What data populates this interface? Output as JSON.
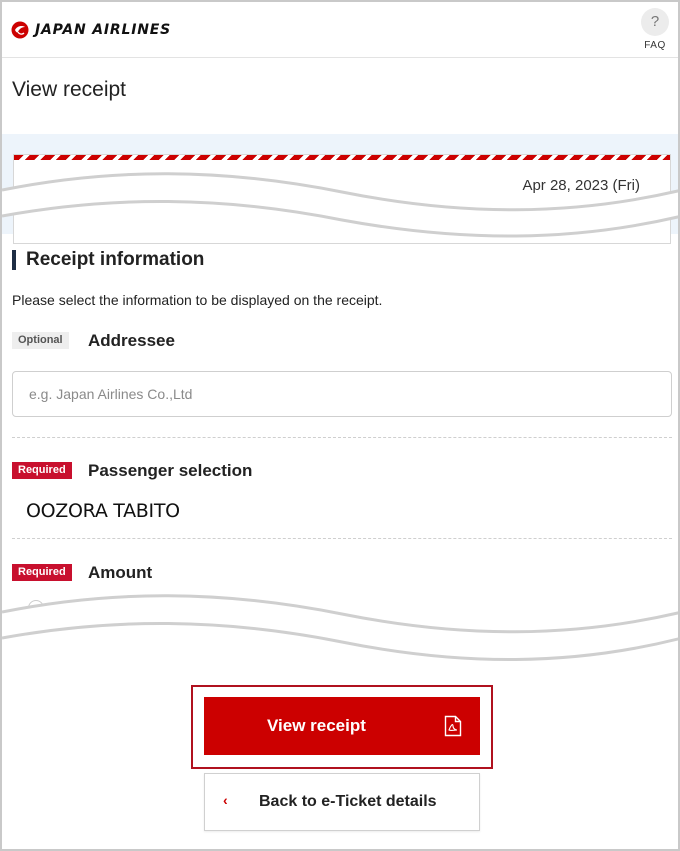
{
  "header": {
    "brand": "JAPAN AIRLINES",
    "faq_icon": "?",
    "faq_label": "FAQ"
  },
  "page": {
    "title": "View receipt"
  },
  "flight_card": {
    "date": "Apr 28, 2023 (Fri)"
  },
  "receipt_info": {
    "title": "Receipt information",
    "instruction": "Please select the information to be displayed on the receipt.",
    "addressee": {
      "badge": "Optional",
      "label": "Addressee",
      "placeholder": "e.g. Japan Airlines Co.,Ltd",
      "value": ""
    },
    "passenger": {
      "badge": "Required",
      "label": "Passenger selection",
      "name": "OOZORA TABITO"
    },
    "amount": {
      "badge": "Required",
      "label": "Amount"
    }
  },
  "actions": {
    "view_receipt_label": "View receipt",
    "view_receipt_icon": "pdf-file-icon",
    "back_label": "Back to e-Ticket details",
    "back_icon": "chevron-left-icon"
  },
  "colors": {
    "brand_red": "#cc0000",
    "required_badge": "#c8102e",
    "highlight_border": "#b0111f",
    "band_blue": "#edf4fb",
    "section_bar": "#1d2d44"
  }
}
